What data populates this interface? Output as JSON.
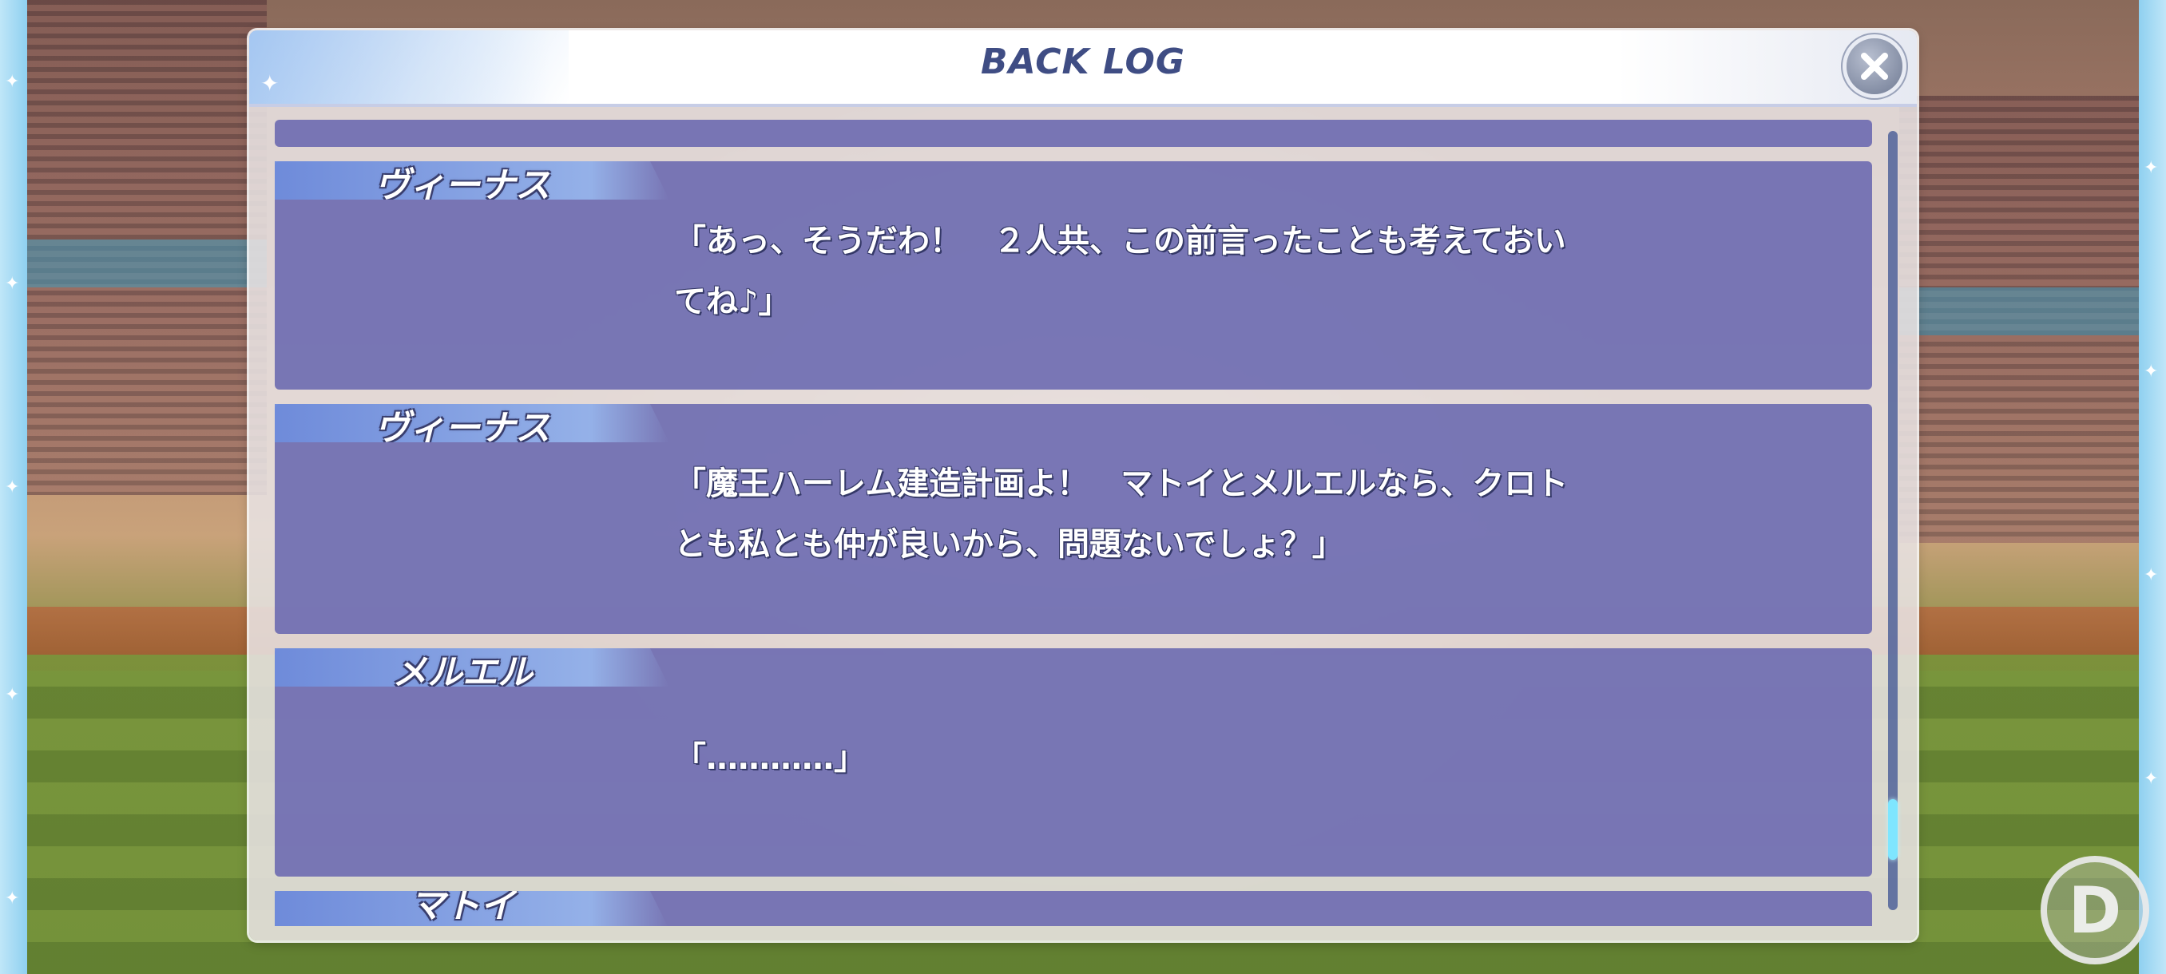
{
  "window": {
    "title": "BACK LOG"
  },
  "entries": [
    {
      "speaker": "",
      "message": ""
    },
    {
      "speaker": "ヴィーナス",
      "message": "「あっ、そうだわ！　２人共、この前言ったことも考えておい\nてね♪」"
    },
    {
      "speaker": "ヴィーナス",
      "message": "「魔王ハーレム建造計画よ！　マトイとメルエルなら、クロト\nとも私とも仲が良いから、問題ないでしょ？」"
    },
    {
      "speaker": "メルエル",
      "message": "「…………」"
    },
    {
      "speaker": "マトイ",
      "message": ""
    }
  ],
  "scrollbar": {
    "position_fraction": 0.93
  },
  "corner_logo": {
    "letter": "D"
  },
  "colors": {
    "entry_bg": "#706eb2",
    "title_color": "#3f4d84",
    "scroll_thumb": "#7fe6ff"
  }
}
